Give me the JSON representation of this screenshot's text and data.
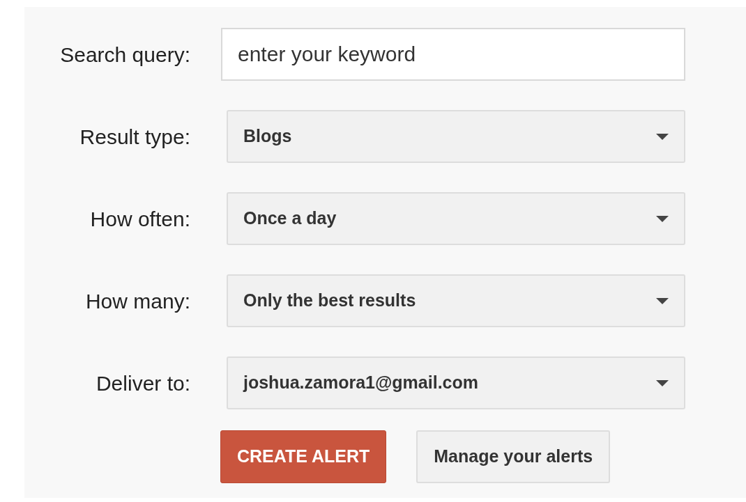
{
  "search_query": {
    "label": "Search query:",
    "placeholder": "enter your keyword"
  },
  "dropdowns": [
    {
      "label": "Result type:",
      "value": "Blogs"
    },
    {
      "label": "How often:",
      "value": "Once a day"
    },
    {
      "label": "How many:",
      "value": "Only the best results"
    },
    {
      "label": "Deliver to:",
      "value": "joshua.zamora1@gmail.com"
    }
  ],
  "buttons": [
    {
      "kind": "primary",
      "label": "CREATE ALERT"
    },
    {
      "kind": "secondary",
      "label": "Manage your alerts"
    }
  ]
}
